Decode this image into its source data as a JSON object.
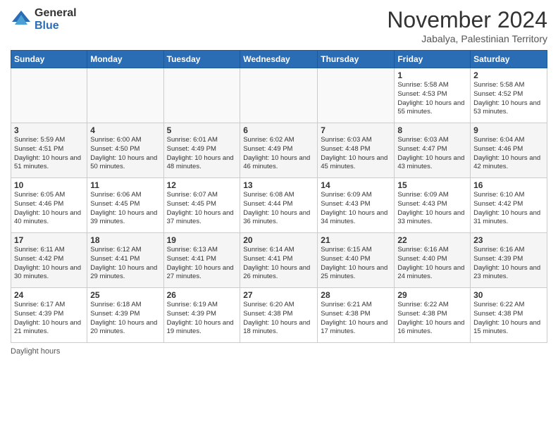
{
  "header": {
    "logo_general": "General",
    "logo_blue": "Blue",
    "month_title": "November 2024",
    "location": "Jabalya, Palestinian Territory"
  },
  "footer": {
    "daylight_label": "Daylight hours"
  },
  "days_of_week": [
    "Sunday",
    "Monday",
    "Tuesday",
    "Wednesday",
    "Thursday",
    "Friday",
    "Saturday"
  ],
  "weeks": [
    [
      {
        "day": "",
        "info": ""
      },
      {
        "day": "",
        "info": ""
      },
      {
        "day": "",
        "info": ""
      },
      {
        "day": "",
        "info": ""
      },
      {
        "day": "",
        "info": ""
      },
      {
        "day": "1",
        "info": "Sunrise: 5:58 AM\nSunset: 4:53 PM\nDaylight: 10 hours\nand 55 minutes."
      },
      {
        "day": "2",
        "info": "Sunrise: 5:58 AM\nSunset: 4:52 PM\nDaylight: 10 hours\nand 53 minutes."
      }
    ],
    [
      {
        "day": "3",
        "info": "Sunrise: 5:59 AM\nSunset: 4:51 PM\nDaylight: 10 hours\nand 51 minutes."
      },
      {
        "day": "4",
        "info": "Sunrise: 6:00 AM\nSunset: 4:50 PM\nDaylight: 10 hours\nand 50 minutes."
      },
      {
        "day": "5",
        "info": "Sunrise: 6:01 AM\nSunset: 4:49 PM\nDaylight: 10 hours\nand 48 minutes."
      },
      {
        "day": "6",
        "info": "Sunrise: 6:02 AM\nSunset: 4:49 PM\nDaylight: 10 hours\nand 46 minutes."
      },
      {
        "day": "7",
        "info": "Sunrise: 6:03 AM\nSunset: 4:48 PM\nDaylight: 10 hours\nand 45 minutes."
      },
      {
        "day": "8",
        "info": "Sunrise: 6:03 AM\nSunset: 4:47 PM\nDaylight: 10 hours\nand 43 minutes."
      },
      {
        "day": "9",
        "info": "Sunrise: 6:04 AM\nSunset: 4:46 PM\nDaylight: 10 hours\nand 42 minutes."
      }
    ],
    [
      {
        "day": "10",
        "info": "Sunrise: 6:05 AM\nSunset: 4:46 PM\nDaylight: 10 hours\nand 40 minutes."
      },
      {
        "day": "11",
        "info": "Sunrise: 6:06 AM\nSunset: 4:45 PM\nDaylight: 10 hours\nand 39 minutes."
      },
      {
        "day": "12",
        "info": "Sunrise: 6:07 AM\nSunset: 4:45 PM\nDaylight: 10 hours\nand 37 minutes."
      },
      {
        "day": "13",
        "info": "Sunrise: 6:08 AM\nSunset: 4:44 PM\nDaylight: 10 hours\nand 36 minutes."
      },
      {
        "day": "14",
        "info": "Sunrise: 6:09 AM\nSunset: 4:43 PM\nDaylight: 10 hours\nand 34 minutes."
      },
      {
        "day": "15",
        "info": "Sunrise: 6:09 AM\nSunset: 4:43 PM\nDaylight: 10 hours\nand 33 minutes."
      },
      {
        "day": "16",
        "info": "Sunrise: 6:10 AM\nSunset: 4:42 PM\nDaylight: 10 hours\nand 31 minutes."
      }
    ],
    [
      {
        "day": "17",
        "info": "Sunrise: 6:11 AM\nSunset: 4:42 PM\nDaylight: 10 hours\nand 30 minutes."
      },
      {
        "day": "18",
        "info": "Sunrise: 6:12 AM\nSunset: 4:41 PM\nDaylight: 10 hours\nand 29 minutes."
      },
      {
        "day": "19",
        "info": "Sunrise: 6:13 AM\nSunset: 4:41 PM\nDaylight: 10 hours\nand 27 minutes."
      },
      {
        "day": "20",
        "info": "Sunrise: 6:14 AM\nSunset: 4:41 PM\nDaylight: 10 hours\nand 26 minutes."
      },
      {
        "day": "21",
        "info": "Sunrise: 6:15 AM\nSunset: 4:40 PM\nDaylight: 10 hours\nand 25 minutes."
      },
      {
        "day": "22",
        "info": "Sunrise: 6:16 AM\nSunset: 4:40 PM\nDaylight: 10 hours\nand 24 minutes."
      },
      {
        "day": "23",
        "info": "Sunrise: 6:16 AM\nSunset: 4:39 PM\nDaylight: 10 hours\nand 23 minutes."
      }
    ],
    [
      {
        "day": "24",
        "info": "Sunrise: 6:17 AM\nSunset: 4:39 PM\nDaylight: 10 hours\nand 21 minutes."
      },
      {
        "day": "25",
        "info": "Sunrise: 6:18 AM\nSunset: 4:39 PM\nDaylight: 10 hours\nand 20 minutes."
      },
      {
        "day": "26",
        "info": "Sunrise: 6:19 AM\nSunset: 4:39 PM\nDaylight: 10 hours\nand 19 minutes."
      },
      {
        "day": "27",
        "info": "Sunrise: 6:20 AM\nSunset: 4:38 PM\nDaylight: 10 hours\nand 18 minutes."
      },
      {
        "day": "28",
        "info": "Sunrise: 6:21 AM\nSunset: 4:38 PM\nDaylight: 10 hours\nand 17 minutes."
      },
      {
        "day": "29",
        "info": "Sunrise: 6:22 AM\nSunset: 4:38 PM\nDaylight: 10 hours\nand 16 minutes."
      },
      {
        "day": "30",
        "info": "Sunrise: 6:22 AM\nSunset: 4:38 PM\nDaylight: 10 hours\nand 15 minutes."
      }
    ]
  ]
}
